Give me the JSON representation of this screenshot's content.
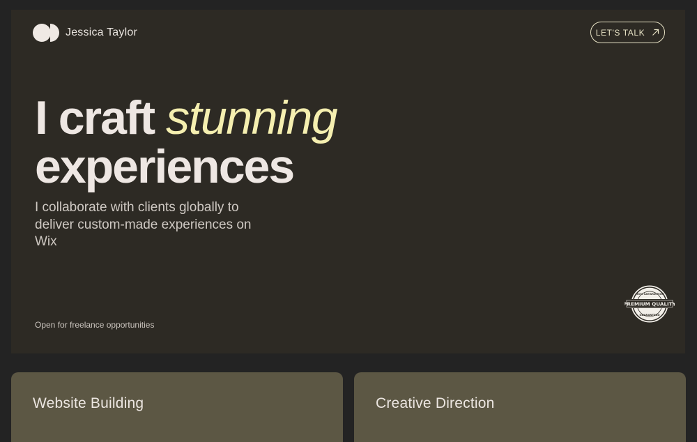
{
  "header": {
    "brand_name": "Jessica Taylor",
    "logo_icon": "overlapping-circles-logo",
    "cta_label": "LET'S TALK",
    "cta_icon": "arrow-up-right-icon"
  },
  "hero": {
    "headline_prefix": "I craft ",
    "headline_accent": "stunning",
    "headline_line2": "experiences",
    "subtext": "I collaborate with clients globally to deliver custom-made experiences on Wix",
    "status_text": "Open for freelance opportunities",
    "badge": {
      "top_text": "100% SATISFACTION",
      "middle_text": "PREMIUM QUALITY",
      "bottom_text": "GUARANTEED"
    }
  },
  "services": [
    {
      "title": "Website Building"
    },
    {
      "title": "Creative Direction"
    }
  ],
  "colors": {
    "page_background": "#232323",
    "hero_background": "#2d2a24",
    "accent": "#f5efb0",
    "card_background": "#5c5744",
    "text_primary": "#eee7e3"
  }
}
